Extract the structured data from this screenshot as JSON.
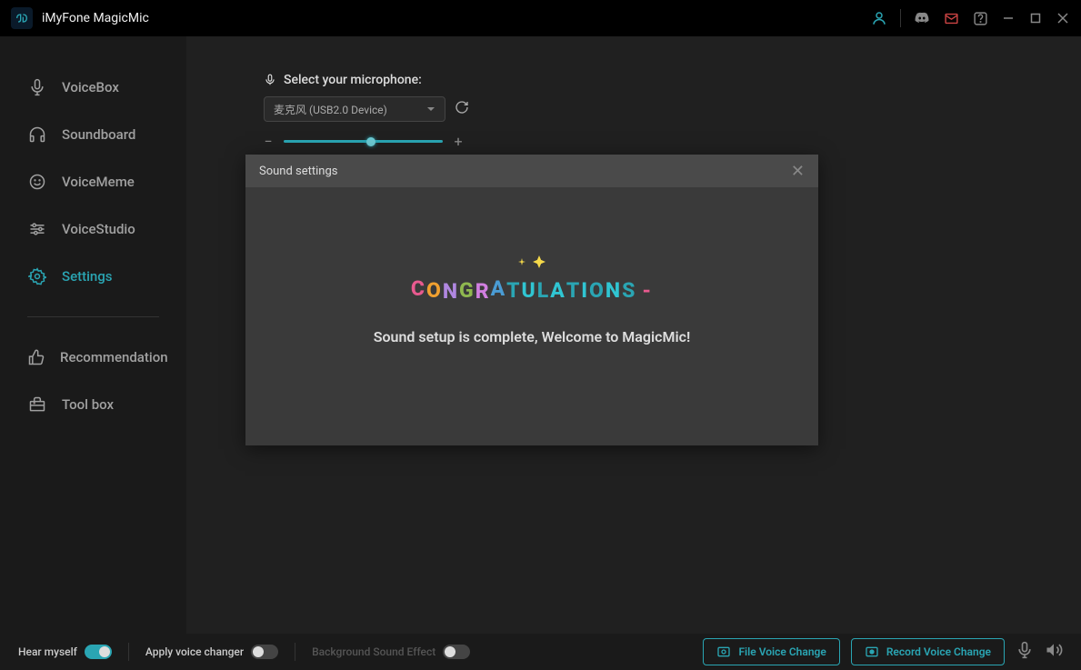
{
  "app": {
    "title": "iMyFone MagicMic"
  },
  "sidebar": {
    "items": [
      {
        "label": "VoiceBox"
      },
      {
        "label": "Soundboard"
      },
      {
        "label": "VoiceMeme"
      },
      {
        "label": "VoiceStudio"
      },
      {
        "label": "Settings"
      },
      {
        "label": "Recommendation"
      },
      {
        "label": "Tool box"
      }
    ]
  },
  "mic": {
    "section_label": "Select your microphone:",
    "selected": "麦克风 (USB2.0 Device)"
  },
  "modal": {
    "title": "Sound settings",
    "congrats": "CONGRATULATIONS",
    "welcome": "Sound setup is complete, Welcome to MagicMic!"
  },
  "footer": {
    "hear": "Hear myself",
    "apply": "Apply voice changer",
    "bg": "Background Sound Effect",
    "file_btn": "File Voice Change",
    "record_btn": "Record Voice Change"
  }
}
